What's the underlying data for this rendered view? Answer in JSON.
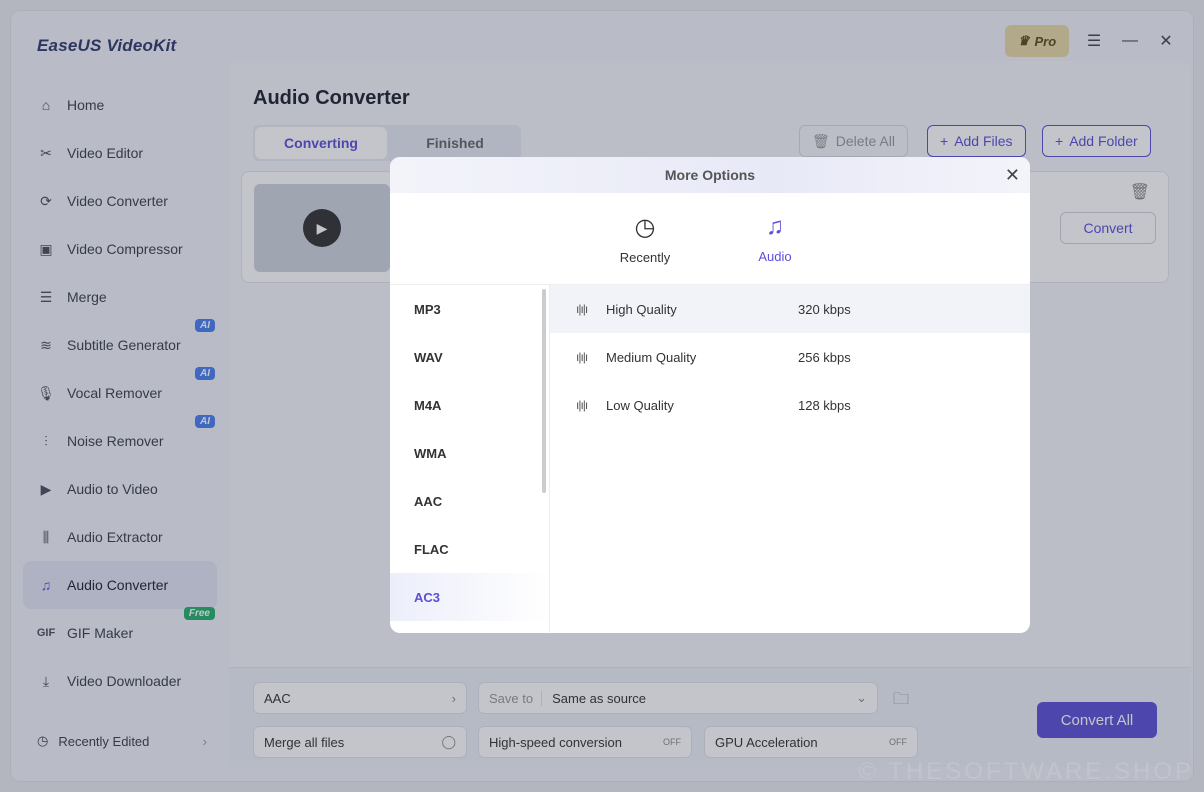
{
  "app": {
    "title": "EaseUS VideoKit",
    "pro_label": "Pro"
  },
  "sidebar": {
    "items": [
      {
        "label": "Home",
        "icon": "home-icon"
      },
      {
        "label": "Video Editor",
        "icon": "scissors-icon"
      },
      {
        "label": "Video Converter",
        "icon": "convert-icon"
      },
      {
        "label": "Video Compressor",
        "icon": "compress-icon"
      },
      {
        "label": "Merge",
        "icon": "merge-icon"
      },
      {
        "label": "Subtitle Generator",
        "icon": "subtitle-icon",
        "badge": "AI"
      },
      {
        "label": "Vocal Remover",
        "icon": "mic-icon",
        "badge": "AI"
      },
      {
        "label": "Noise Remover",
        "icon": "sliders-icon",
        "badge": "AI"
      },
      {
        "label": "Audio to Video",
        "icon": "video-icon"
      },
      {
        "label": "Audio Extractor",
        "icon": "waveform-icon"
      },
      {
        "label": "Audio Converter",
        "icon": "music-icon",
        "active": true
      },
      {
        "label": "GIF Maker",
        "icon": "gif-icon",
        "badge": "Free"
      },
      {
        "label": "Video Downloader",
        "icon": "download-icon"
      }
    ],
    "recent": "Recently Edited"
  },
  "main": {
    "title": "Audio Converter",
    "tabs": [
      "Converting",
      "Finished"
    ],
    "delete_all": "Delete All",
    "add_files": "Add Files",
    "add_folder": "Add Folder",
    "convert": "Convert"
  },
  "bottom": {
    "format": "AAC",
    "save_to_label": "Save to",
    "save_to_value": "Same as source",
    "merge": "Merge all files",
    "highspeed": "High-speed conversion",
    "gpu": "GPU Acceleration",
    "convert_all": "Convert All",
    "off": "OFF"
  },
  "modal": {
    "title": "More Options",
    "tabs": [
      "Recently",
      "Audio"
    ],
    "formats": [
      "MP3",
      "WAV",
      "M4A",
      "WMA",
      "AAC",
      "FLAC",
      "AC3"
    ],
    "qualities": [
      {
        "name": "High Quality",
        "rate": "320 kbps"
      },
      {
        "name": "Medium Quality",
        "rate": "256 kbps"
      },
      {
        "name": "Low Quality",
        "rate": "128 kbps"
      }
    ]
  },
  "watermark": "© THESOFTWARE.SHOP",
  "colors": {
    "accent": "#5b4fd6"
  }
}
